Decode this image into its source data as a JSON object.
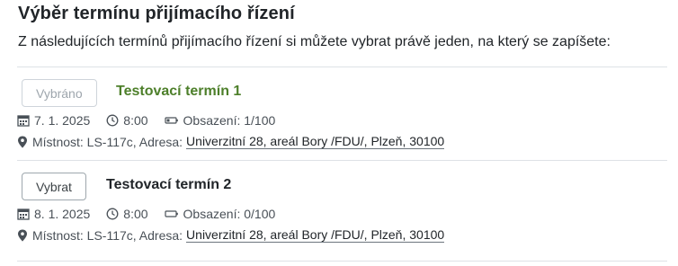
{
  "title": "Výběr termínu přijímacího řízení",
  "subtitle": "Z následujících termínů přijímacího řízení si můžete vybrat právě jeden, na který se zapíšete:",
  "colors": {
    "selected_name": "#4d7f2a",
    "divider": "#dee2e6"
  },
  "terms": [
    {
      "button_label": "Vybráno",
      "name": "Testovací termín 1",
      "date": "7. 1. 2025",
      "time": "8:00",
      "occupancy": "Obsazení: 1/100",
      "room_text": "Místnost: LS-117c, Adresa:",
      "address": "Univerzitní 28, areál Bory /FDU/, Plzeň, 30100",
      "selected": true
    },
    {
      "button_label": "Vybrat",
      "name": "Testovací termín 2",
      "date": "8. 1. 2025",
      "time": "8:00",
      "occupancy": "Obsazení: 0/100",
      "room_text": "Místnost: LS-117c, Adresa:",
      "address": "Univerzitní 28, areál Bory /FDU/, Plzeň, 30100",
      "selected": false
    }
  ]
}
